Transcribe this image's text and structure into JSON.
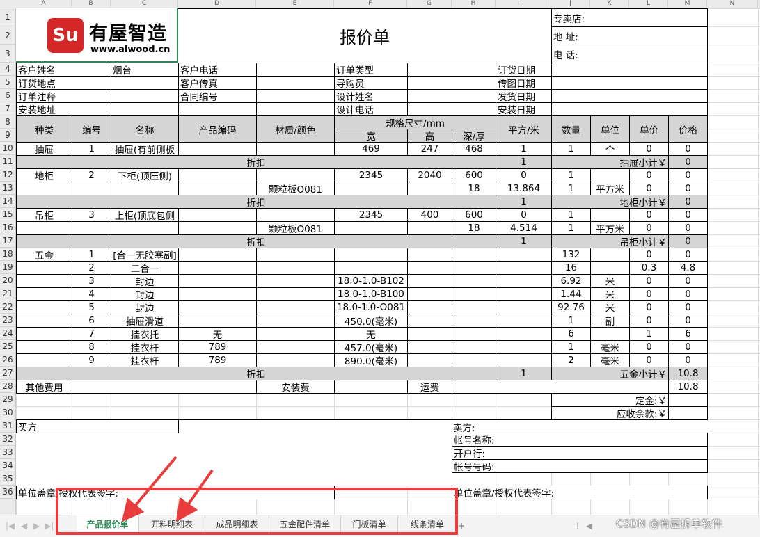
{
  "col_headers": [
    "A",
    "B",
    "C",
    "D",
    "E",
    "F",
    "G",
    "H",
    "I",
    "J",
    "K",
    "L",
    "M",
    "N"
  ],
  "row_headers": [
    "1",
    "2",
    "3",
    "4",
    "5",
    "6",
    "7",
    "8",
    "9",
    "10",
    "11",
    "12",
    "13",
    "14",
    "15",
    "16",
    "17",
    "18",
    "19",
    "20",
    "21",
    "22",
    "23",
    "24",
    "25",
    "26",
    "27",
    "28",
    "29",
    "30",
    "31",
    "32",
    "33",
    "34",
    "35",
    "36"
  ],
  "logo": {
    "mark": "Su",
    "name": "有屋智造",
    "url": "www.aiwood.cn"
  },
  "sheet": {
    "title": "报价单",
    "store_label": "专卖店:",
    "address_label": "地 址:",
    "phone_label": "电 话:",
    "info": [
      [
        "客户姓名",
        "烟台",
        "客户电话",
        "",
        "订单类型",
        "",
        "订货日期",
        ""
      ],
      [
        "订货地点",
        "",
        "客户传真",
        "",
        "导购员",
        "",
        "传图日期",
        ""
      ],
      [
        "订单注释",
        "",
        "合同编号",
        "",
        "设计姓名",
        "",
        "发货日期",
        ""
      ],
      [
        "安装地址",
        "",
        "",
        "",
        "设计电话",
        "",
        "安装日期",
        ""
      ]
    ],
    "header": {
      "type": "种类",
      "no": "编号",
      "name": "名称",
      "code": "产品编码",
      "material": "材质/颜色",
      "spec": "规格尺寸/mm",
      "w": "宽",
      "h": "高",
      "d": "深/厚",
      "area": "平方/米",
      "qty": "数量",
      "unit": "单位",
      "price": "单价",
      "amount": "价格"
    },
    "rows": {
      "r10": [
        "抽屉",
        "1",
        "抽屉(有前侧板",
        "",
        "",
        "469",
        "247",
        "468",
        "1",
        "1",
        "个",
        "0",
        "0"
      ],
      "r11": [
        "折扣",
        "1",
        "抽屉小计￥",
        "0"
      ],
      "r12": [
        "地柜",
        "2",
        "下柜(顶压侧)",
        "",
        "",
        "2345",
        "2040",
        "600",
        "0",
        "1",
        "",
        "0",
        "0"
      ],
      "r13": [
        "",
        "",
        "",
        "",
        "颗粒板O081",
        "",
        "",
        "18",
        "13.864",
        "1",
        "平方米",
        "0",
        "0"
      ],
      "r14": [
        "折扣",
        "1",
        "地柜小计￥",
        "0"
      ],
      "r15": [
        "吊柜",
        "3",
        "上柜(顶底包侧",
        "",
        "",
        "2345",
        "400",
        "600",
        "0",
        "1",
        "",
        "0",
        "0"
      ],
      "r16": [
        "",
        "",
        "",
        "",
        "颗粒板O081",
        "",
        "",
        "18",
        "4.514",
        "1",
        "平方米",
        "0",
        "0"
      ],
      "r17": [
        "折扣",
        "1",
        "吊柜小计￥",
        "0"
      ],
      "r18": [
        "五金",
        "1",
        "[合一无胶塞副]",
        "",
        "",
        "",
        "",
        "",
        "",
        "132",
        "",
        "0",
        "0"
      ],
      "r19": [
        "",
        "2",
        "二合一",
        "",
        "",
        "",
        "",
        "",
        "",
        "16",
        "",
        "0.3",
        "4.8"
      ],
      "r20": [
        "",
        "3",
        "封边",
        "",
        "",
        "18.0-1.0-B102",
        "",
        "",
        "",
        "6.92",
        "米",
        "0",
        "0"
      ],
      "r21": [
        "",
        "4",
        "封边",
        "",
        "",
        "18.0-1.0-B100",
        "",
        "",
        "",
        "1.44",
        "米",
        "0",
        "0"
      ],
      "r22": [
        "",
        "5",
        "封边",
        "",
        "",
        "18.0-1.0-O081",
        "",
        "",
        "",
        "92.76",
        "米",
        "0",
        "0"
      ],
      "r23": [
        "",
        "6",
        "抽屉滑道",
        "",
        "",
        "450.0(毫米)",
        "",
        "",
        "",
        "1",
        "副",
        "0",
        "0"
      ],
      "r24": [
        "",
        "7",
        "挂衣托",
        "无",
        "",
        "无",
        "",
        "",
        "",
        "6",
        "",
        "1",
        "6"
      ],
      "r25": [
        "",
        "8",
        "挂衣杆",
        "789",
        "",
        "457.0(毫米)",
        "",
        "",
        "",
        "1",
        "毫米",
        "0",
        "0"
      ],
      "r26": [
        "",
        "9",
        "挂衣杆",
        "789",
        "",
        "890.0(毫米)",
        "",
        "",
        "",
        "2",
        "毫米",
        "0",
        "0"
      ],
      "r27": [
        "折扣",
        "1",
        "五金小计￥",
        "10.8"
      ]
    },
    "other_fee": {
      "label": "其他费用",
      "install": "安装费",
      "shipping": "运费",
      "total": "10.8"
    },
    "deposit_label": "定金:￥",
    "balance_label": "应收余款:￥",
    "buyer_label": "买方",
    "seller_label": "卖方:",
    "account_name_label": "帐号名称:",
    "bank_label": "开户行:",
    "account_no_label": "帐号号码:",
    "sign_left": "单位盖章/授权代表签字:",
    "sign_right": "单位盖章/授权代表签字:"
  },
  "tabs": [
    "产品报价单",
    "开料明细表",
    "成品明细表",
    "五金配件清单",
    "门板清单",
    "线条清单"
  ],
  "active_tab": 0,
  "add_tab_label": "+",
  "watermark": "CSDN @有屋拆单软件",
  "colors": {
    "accent": "#2e8b57",
    "highlight": "#ea3c3c",
    "subtotal_bg": "#d5d5d5",
    "logo_red": "#d42727"
  }
}
